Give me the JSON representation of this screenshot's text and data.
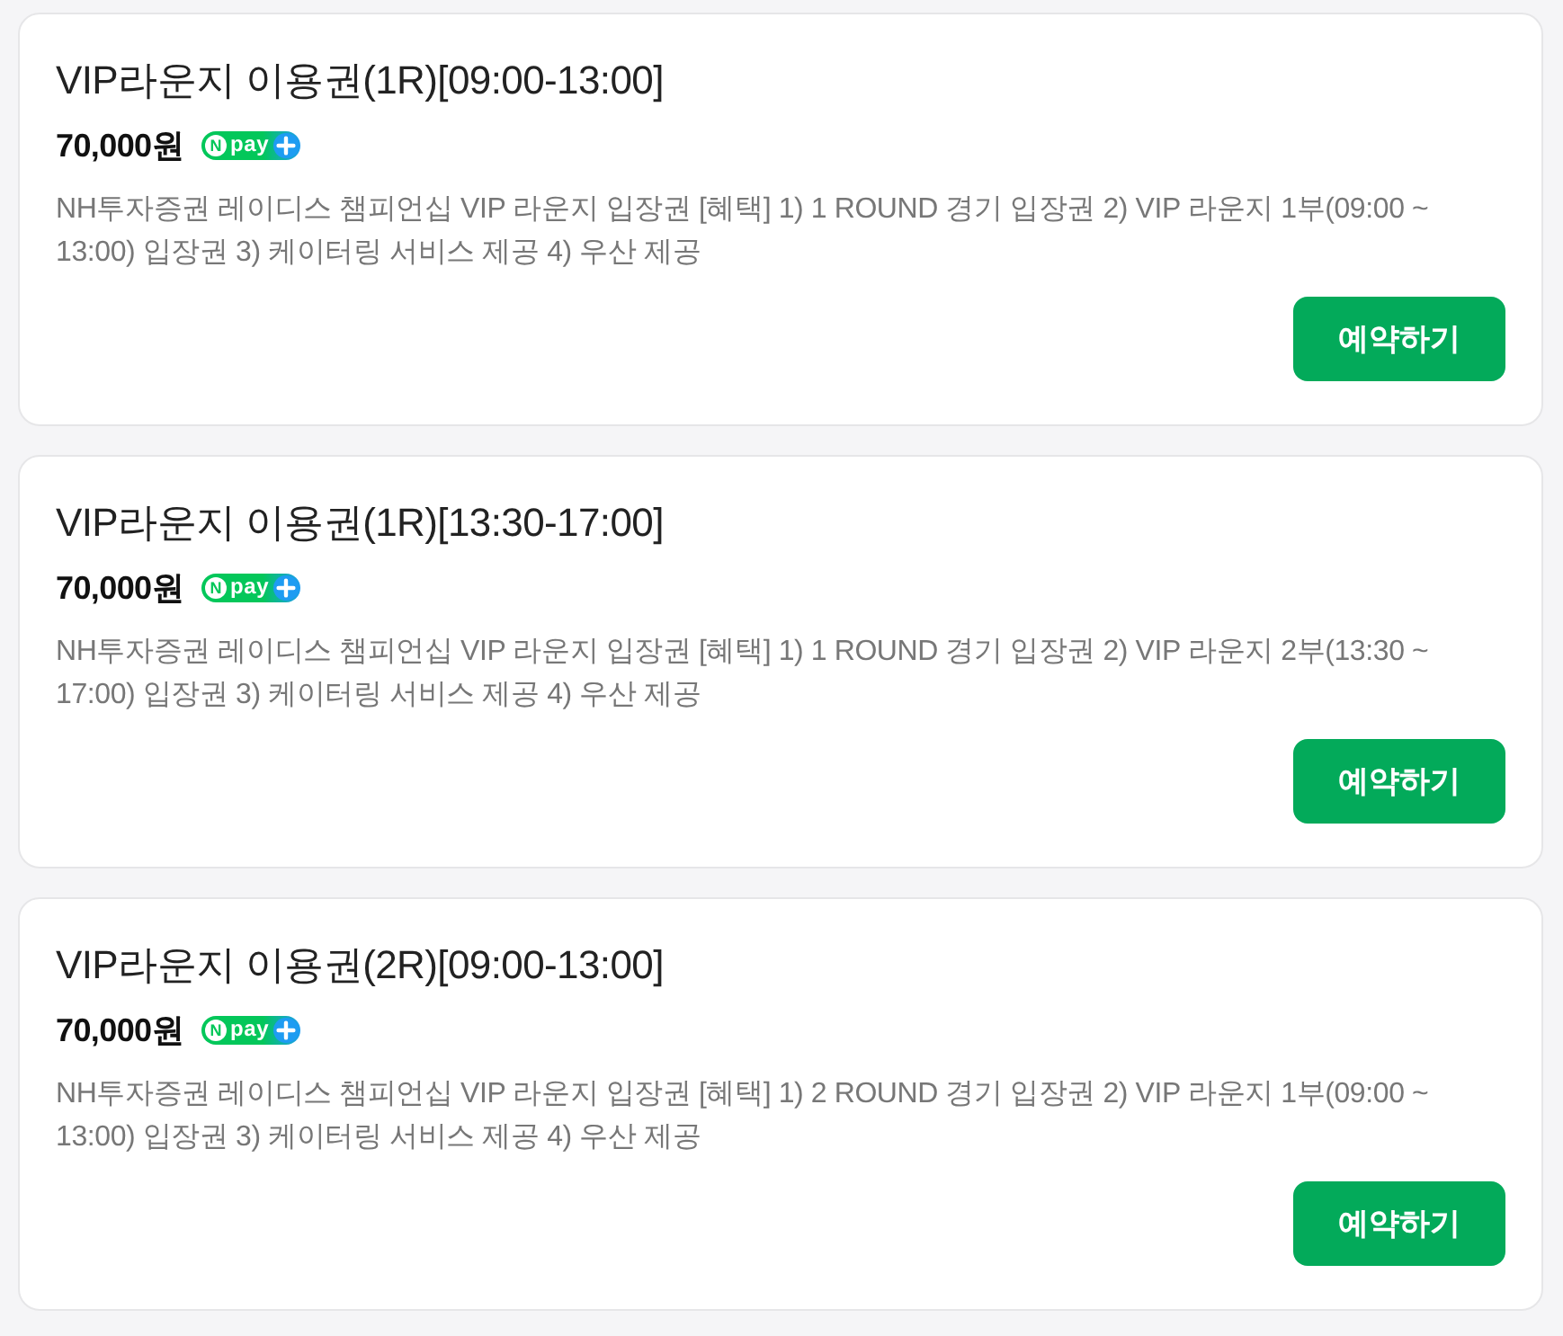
{
  "products": [
    {
      "title": "VIP라운지 이용권(1R)[09:00-13:00]",
      "price": "70,000원",
      "npay": {
        "n": "N",
        "label": "pay"
      },
      "description": "NH투자증권 레이디스 챔피언십 VIP 라운지 입장권 [혜택] 1) 1 ROUND 경기 입장권 2) VIP 라운지 1부(09:00 ~ 13:00) 입장권 3) 케이터링 서비스 제공 4) 우산 제공",
      "button": "예약하기"
    },
    {
      "title": "VIP라운지 이용권(1R)[13:30-17:00]",
      "price": "70,000원",
      "npay": {
        "n": "N",
        "label": "pay"
      },
      "description": "NH투자증권 레이디스 챔피언십 VIP 라운지 입장권 [혜택] 1) 1 ROUND 경기 입장권 2) VIP 라운지 2부(13:30 ~ 17:00) 입장권 3) 케이터링 서비스 제공 4) 우산 제공",
      "button": "예약하기"
    },
    {
      "title": "VIP라운지 이용권(2R)[09:00-13:00]",
      "price": "70,000원",
      "npay": {
        "n": "N",
        "label": "pay"
      },
      "description": "NH투자증권 레이디스 챔피언십 VIP 라운지 입장권 [혜택] 1) 2 ROUND 경기 입장권 2) VIP 라운지 1부(09:00 ~ 13:00) 입장권 3) 케이터링 서비스 제공 4) 우산 제공",
      "button": "예약하기"
    }
  ]
}
